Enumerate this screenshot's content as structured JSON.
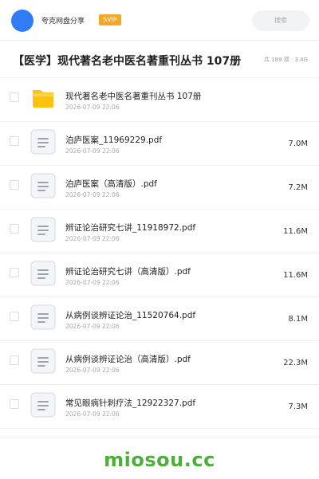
{
  "header": {
    "username": "夸克网盘分享",
    "vip_badge": "SVIP",
    "search_placeholder": "搜索"
  },
  "folder": {
    "title": "【医学】现代著名老中医名著重刊丛书 107册",
    "meta": "共 189 项 · 3.4G"
  },
  "files": [
    {
      "name": "现代著名老中医名著重刊丛书 107册",
      "date": "2026-07-09 22:06",
      "size": "",
      "type": "folder"
    },
    {
      "name": "泊庐医案_11969229.pdf",
      "date": "2026-07-09 22:06",
      "size": "7.0M",
      "type": "pdf"
    },
    {
      "name": "泊庐医案（高清版）.pdf",
      "date": "2026-07-09 22:06",
      "size": "7.2M",
      "type": "pdf"
    },
    {
      "name": "辨证论治研究七讲_11918972.pdf",
      "date": "2026-07-09 22:06",
      "size": "11.6M",
      "type": "pdf"
    },
    {
      "name": "辨证论治研究七讲（高清版）.pdf",
      "date": "2026-07-09 22:06",
      "size": "11.6M",
      "type": "pdf"
    },
    {
      "name": "从病例谈辨证论治_11520764.pdf",
      "date": "2026-07-09 22:06",
      "size": "8.1M",
      "type": "pdf"
    },
    {
      "name": "从病例谈辨证论治（高清版）.pdf",
      "date": "2026-07-09 22:06",
      "size": "22.3M",
      "type": "pdf"
    },
    {
      "name": "常见眼病针刺疗法_12922327.pdf",
      "date": "2026-07-09 22:06",
      "size": "7.3M",
      "type": "pdf"
    }
  ],
  "watermark": "miosou.cc",
  "colors": {
    "accent": "#2f7cf6",
    "vip": "#f5a623",
    "folder": "#ffc20e",
    "watermark": "#4caf38"
  }
}
